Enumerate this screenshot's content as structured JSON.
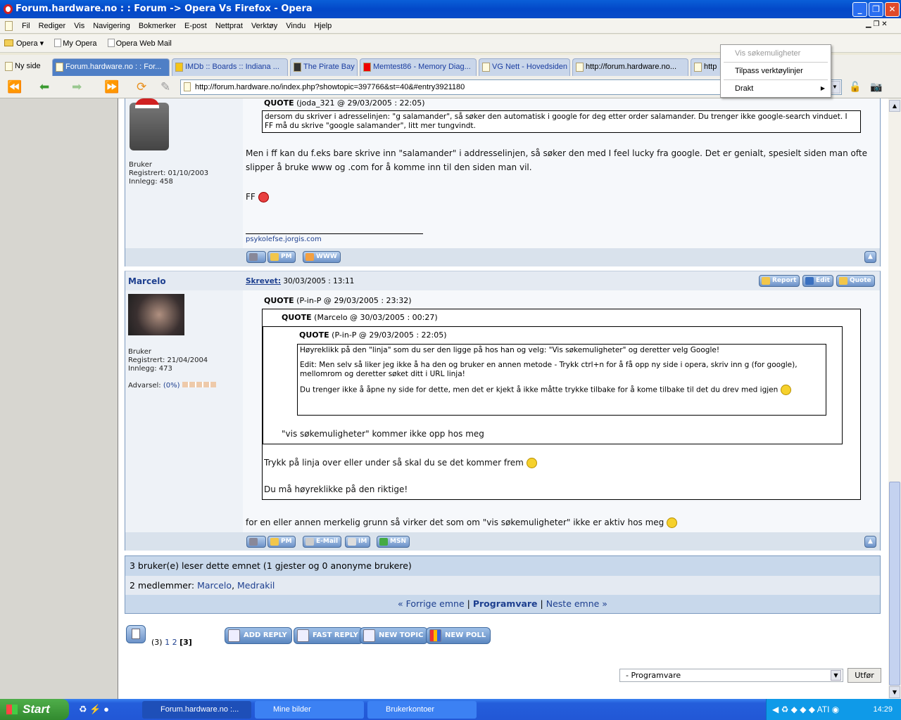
{
  "window": {
    "title": "Forum.hardware.no : : Forum -> Opera Vs Firefox - Opera"
  },
  "menu": [
    "Fil",
    "Rediger",
    "Vis",
    "Navigering",
    "Bokmerker",
    "E-post",
    "Nettprat",
    "Verktøy",
    "Vindu",
    "Hjelp"
  ],
  "bookmarks": [
    "Opera",
    "My Opera",
    "Opera Web Mail"
  ],
  "tabs": [
    "Ny side",
    "Forum.hardware.no : : For...",
    "IMDb :: Boards :: Indiana ...",
    "The Pirate Bay",
    "Memtest86 - Memory Diag...",
    "VG Nett - Hovedsiden",
    "http://forum.hardware.no...",
    "http"
  ],
  "address": "http://forum.hardware.no/index.php?showtopic=397766&st=40&#entry3921180",
  "context_menu": {
    "items": [
      "Vis søkemuligheter",
      "Tilpass verktøylinjer",
      "Drakt"
    ]
  },
  "post1": {
    "user_group": "Bruker",
    "registered": "Registrert: 01/10/2003",
    "posts": "Innlegg: 458",
    "quote_header": "QUOTE",
    "quote_meta": "(joda_321 @ 29/03/2005 : 22:05)",
    "quote_text": "dersom du skriver i adresselinjen: \"g salamander\", så søker den automatisk i google for deg etter order salamander. Du trenger ikke google-search vinduet. I FF må du skrive \"google salamander\", litt mer tungvindt.",
    "text": "Men i ff kan du f.eks bare skrive inn \"salamander\" i addresselinjen, så søker den med I feel lucky fra google. Det er genialt, spesielt siden man ofte slipper å bruke www og .com for å komme inn til den siden man vil.",
    "text2": "FF",
    "signature": "psykolefse.jorgis.com",
    "buttons": [
      "PM",
      "WWW"
    ]
  },
  "post2": {
    "username": "Marcelo",
    "written_label": "Skrevet:",
    "date": "30/03/2005 : 13:11",
    "actions": [
      "Report",
      "Edit",
      "Quote"
    ],
    "user_group": "Bruker",
    "registered": "Registrert: 21/04/2004",
    "posts": "Innlegg: 473",
    "warning_label": "Advarsel:",
    "warning_value": "(0%)",
    "q1_meta": "(P-in-P @ 29/03/2005 : 23:32)",
    "q2_meta": "(Marcelo @ 30/03/2005 : 00:27)",
    "q3_meta": "(P-in-P @ 29/03/2005 : 22:05)",
    "quote_label": "QUOTE",
    "q3_p1": "Høyreklikk på den \"linja\" som du ser den ligge på hos han og velg: \"Vis søkemuligheter\" og deretter velg Google!",
    "q3_p2": "Edit: Men selv så liker jeg ikke å ha den og bruker en annen metode - Trykk ctrl+n for å få opp ny side i opera, skriv inn g (for google), mellomrom og deretter søket ditt i URL linja!",
    "q3_p3": "Du trenger ikke å åpne ny side for dette, men det er kjekt å ikke måtte trykke tilbake for å kome tilbake til det du drev med igjen",
    "q2_text": "\"vis søkemuligheter\" kommer ikke opp hos meg",
    "q1_text1": "Trykk på linja over eller under så skal du se det kommer frem",
    "q1_text2": "Du må høyreklikke på den riktige!",
    "text": "for en eller annen merkelig grunn så virker det som om \"vis søkemuligheter\" ikke er aktiv hos meg",
    "buttons": [
      "PM",
      "E-Mail",
      "IM",
      "MSN"
    ]
  },
  "stats": {
    "readers": "3 bruker(e) leser dette emnet (1 gjester og 0 anonyme brukere)",
    "members_label": "2 medlemmer:",
    "members": [
      "Marcelo",
      "Medrakil"
    ]
  },
  "topic_nav": {
    "prev": "« Forrige emne",
    "forum": "Programvare",
    "next": "Neste emne »",
    "sep": "|"
  },
  "pagination": {
    "count": "(3)",
    "pages": [
      "1",
      "2"
    ],
    "current": "[3]"
  },
  "action_buttons": [
    "ADD REPLY",
    "FAST REPLY",
    "NEW TOPIC",
    "NEW POLL"
  ],
  "jump": {
    "selected": "- Programvare",
    "go": "Utfør"
  },
  "taskbar": {
    "start": "Start",
    "tasks": [
      "Forum.hardware.no :...",
      "Mine bilder",
      "Brukerkontoer"
    ],
    "clock": "14:29"
  }
}
